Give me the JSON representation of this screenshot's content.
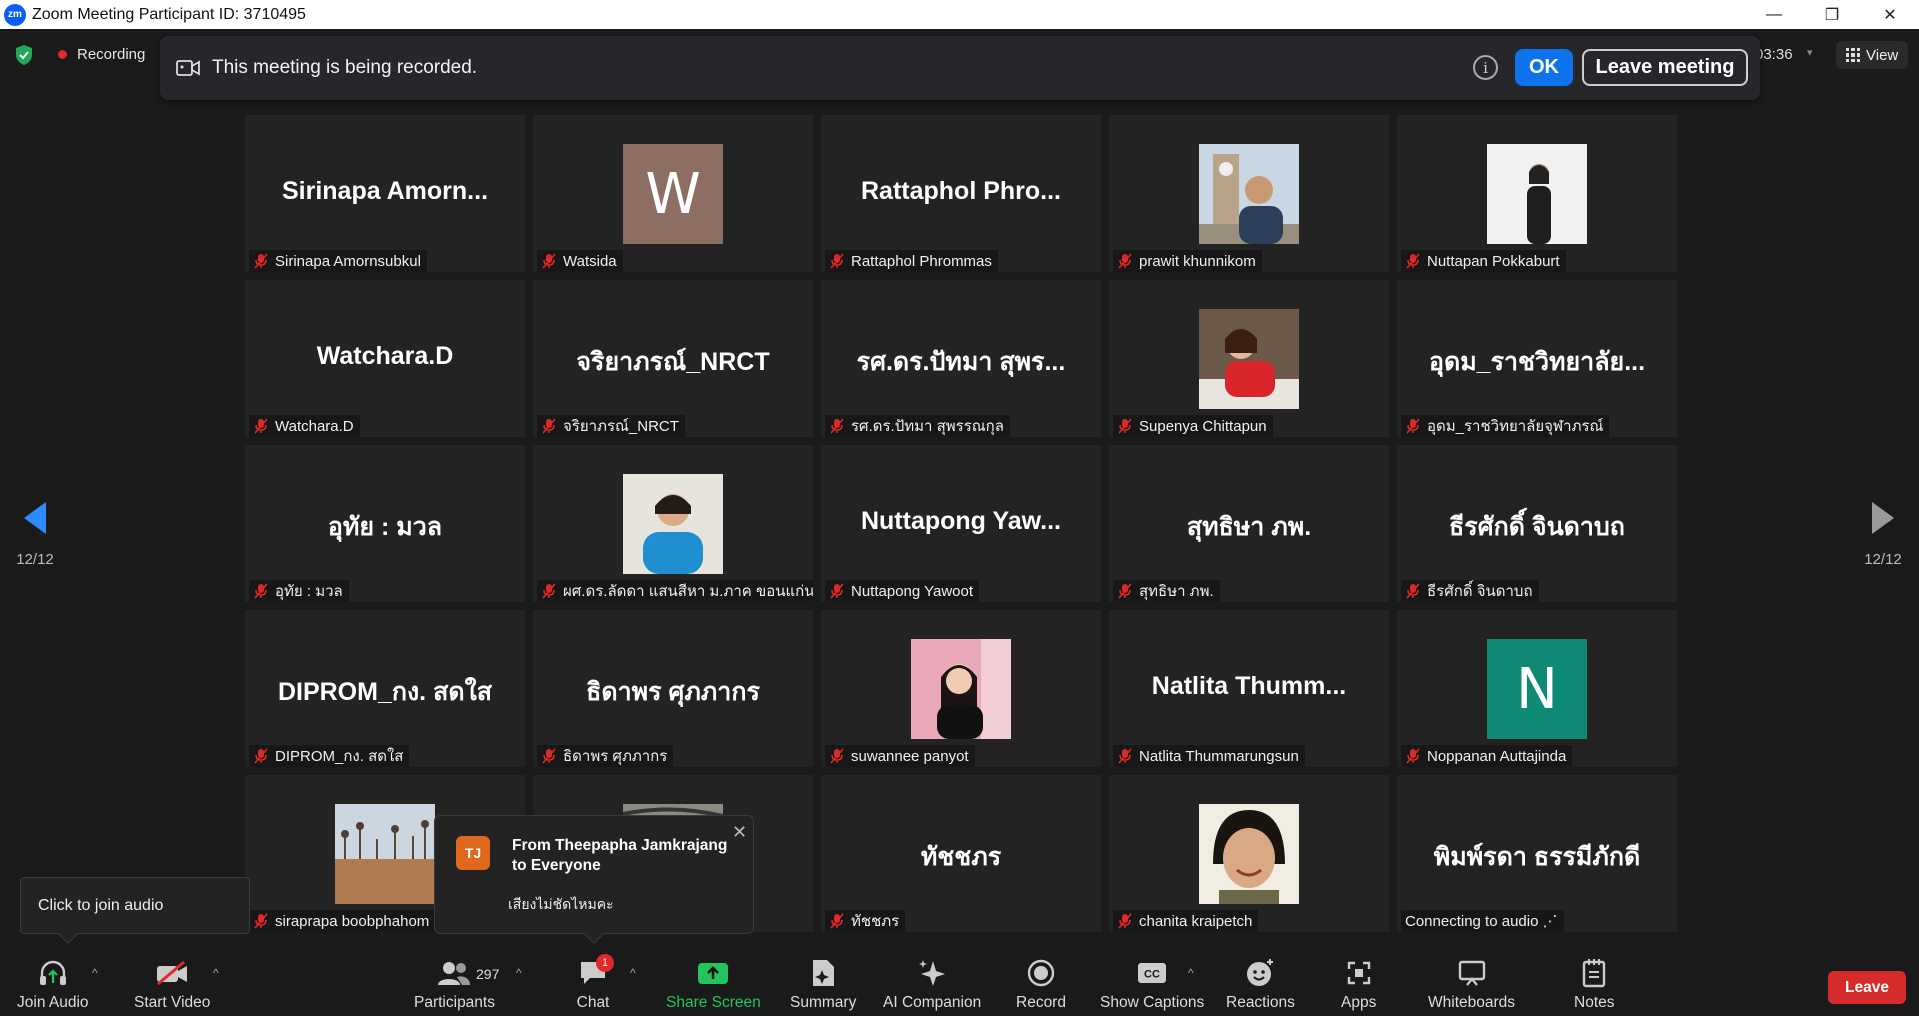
{
  "window": {
    "title": "Zoom Meeting Participant ID: 3710495",
    "logo_text": "zm",
    "minimize": "—",
    "maximize": "❐",
    "close": "✕"
  },
  "status": {
    "recording_label": "Recording",
    "timer": "03:36",
    "view_label": "View"
  },
  "banner": {
    "message": "This meeting is being recorded.",
    "info_icon": "i",
    "ok_label": "OK",
    "leave_label": "Leave meeting"
  },
  "participants_grid": [
    [
      {
        "display_name": "Sirinapa  Amorn...",
        "label": "Sirinapa Amornsubkul",
        "kind": "name"
      },
      {
        "display_name": "W",
        "label": "Watsida",
        "kind": "letter",
        "color": "#8d6e63"
      },
      {
        "display_name": "Rattaphol  Phro...",
        "label": "Rattaphol Phrommas",
        "kind": "name"
      },
      {
        "display_name": "",
        "label": "prawit khunnikom",
        "kind": "photo",
        "photo": "man-clocktower"
      },
      {
        "display_name": "",
        "label": "Nuttapan Pokkaburt",
        "kind": "photo",
        "photo": "woman-standing"
      }
    ],
    [
      {
        "display_name": "Watchara.D",
        "label": "Watchara.D",
        "kind": "name"
      },
      {
        "display_name": "จริยาภรณ์_NRCT",
        "label": "จริยาภรณ์_NRCT",
        "kind": "name"
      },
      {
        "display_name": "รศ.ดร.ปัทมา สุพร...",
        "label": "รศ.ดร.ปัทมา สุพรรณกุล",
        "kind": "name"
      },
      {
        "display_name": "",
        "label": "Supenya Chittapun",
        "kind": "photo",
        "photo": "woman-red"
      },
      {
        "display_name": "อุดม_ราชวิทยาลัย...",
        "label": "อุดม_ราชวิทยาลัยจุฬาภรณ์",
        "kind": "name"
      }
    ],
    [
      {
        "display_name": "อุทัย : มวล",
        "label": "อุทัย : มวล",
        "kind": "name"
      },
      {
        "display_name": "",
        "label": "ผศ.ดร.ลัดดา แสนสีหา ม.ภาค ขอนแก่น",
        "kind": "photo",
        "photo": "woman-blue"
      },
      {
        "display_name": "Nuttapong  Yaw...",
        "label": "Nuttapong Yawoot",
        "kind": "name"
      },
      {
        "display_name": "สุทธิษา ภพ.",
        "label": "สุทธิษา ภพ.",
        "kind": "name"
      },
      {
        "display_name": "ธีรศักดิ์ จินดาบถ",
        "label": "ธีรศักดิ์ จินดาบถ",
        "kind": "name"
      }
    ],
    [
      {
        "display_name": "DIPROM_กง. สดใส",
        "label": "DIPROM_กง. สดใส",
        "kind": "name"
      },
      {
        "display_name": "ธิดาพร ศุภภากร",
        "label": "ธิดาพร ศุภภากร",
        "kind": "name"
      },
      {
        "display_name": "",
        "label": "suwannee panyot",
        "kind": "photo",
        "photo": "woman-pink"
      },
      {
        "display_name": "Natlita  Thumm...",
        "label": "Natlita Thummarungsun",
        "kind": "name"
      },
      {
        "display_name": "N",
        "label": "Noppanan Auttajinda",
        "kind": "letter",
        "color": "#0f8a74"
      }
    ],
    [
      {
        "display_name": "",
        "label": "siraprapa boobphahom",
        "kind": "photo",
        "photo": "field"
      },
      {
        "display_name": "",
        "label": "",
        "kind": "photo",
        "photo": "blur"
      },
      {
        "display_name": "ทัชชภร",
        "label": "ทัชชภร",
        "kind": "name"
      },
      {
        "display_name": "",
        "label": "chanita kraipetch",
        "kind": "photo",
        "photo": "woman-smile"
      },
      {
        "display_name": "พิมพ์รดา ธรรมีภักดี",
        "label": "Connecting to audio ⋰",
        "kind": "name",
        "no_mic": true
      }
    ]
  ],
  "nav": {
    "page_left": "12/12",
    "page_right": "12/12"
  },
  "tooltip": {
    "text": "Click to join audio"
  },
  "chat_popup": {
    "avatar": "TJ",
    "from": "From Theepapha Jamkrajang to Everyone",
    "message": "เสียงไม่ชัดไหมคะ",
    "close": "✕"
  },
  "toolbar": {
    "join_audio": "Join Audio",
    "start_video": "Start Video",
    "participants": "Participants",
    "participant_count": "297",
    "chat": "Chat",
    "chat_badge": "1",
    "share_screen": "Share Screen",
    "summary": "Summary",
    "ai_companion": "AI Companion",
    "record": "Record",
    "show_captions": "Show Captions",
    "captions_icon_text": "CC",
    "reactions": "Reactions",
    "apps": "Apps",
    "whiteboards": "Whiteboards",
    "notes": "Notes",
    "leave": "Leave",
    "caret": "^"
  }
}
